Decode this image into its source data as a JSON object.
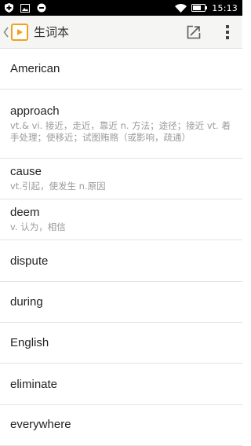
{
  "status_bar": {
    "time": "15:13",
    "left_icons": [
      "shield-icon",
      "image-icon",
      "circle-minus-icon"
    ],
    "right_icons": [
      "wifi-icon",
      "battery-icon"
    ]
  },
  "app_bar": {
    "title": "生词本",
    "back_icon": "chevron-left-icon",
    "logo_icon": "play-icon",
    "actions": [
      "export-icon",
      "more-vertical-icon"
    ],
    "accent_color": "#f0a21b"
  },
  "words": [
    {
      "word": "American",
      "definition": ""
    },
    {
      "word": "approach",
      "definition": "vt.& vi. 接近，走近，靠近  n. 方法；途径；接近  vt. 着手处理；使移近；试图贿赂（或影响，疏通）"
    },
    {
      "word": "cause",
      "definition": "vt.引起，使发生  n.原因"
    },
    {
      "word": "deem",
      "definition": "v. 认为，相信"
    },
    {
      "word": "dispute",
      "definition": ""
    },
    {
      "word": "during",
      "definition": ""
    },
    {
      "word": "English",
      "definition": ""
    },
    {
      "word": "eliminate",
      "definition": ""
    },
    {
      "word": "everywhere",
      "definition": ""
    }
  ]
}
